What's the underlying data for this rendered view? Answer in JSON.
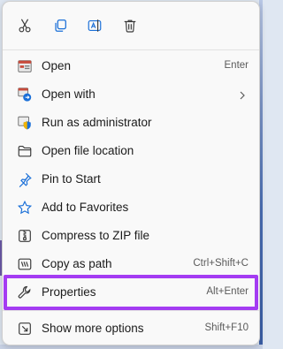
{
  "toolbar": {
    "buttons": [
      {
        "name": "cut",
        "icon": "scissors-icon"
      },
      {
        "name": "copy",
        "icon": "copy-icon"
      },
      {
        "name": "rename",
        "icon": "rename-icon"
      },
      {
        "name": "delete",
        "icon": "trash-icon"
      }
    ]
  },
  "menu": {
    "items": [
      {
        "label": "Open",
        "shortcut": "Enter",
        "icon": "open-app-icon"
      },
      {
        "label": "Open with",
        "shortcut": "",
        "icon": "open-with-icon",
        "has_submenu": true
      },
      {
        "label": "Run as administrator",
        "shortcut": "",
        "icon": "shield-icon"
      },
      {
        "label": "Open file location",
        "shortcut": "",
        "icon": "folder-icon"
      },
      {
        "label": "Pin to Start",
        "shortcut": "",
        "icon": "pin-icon"
      },
      {
        "label": "Add to Favorites",
        "shortcut": "",
        "icon": "star-icon"
      },
      {
        "label": "Compress to ZIP file",
        "shortcut": "",
        "icon": "zip-icon"
      },
      {
        "label": "Copy as path",
        "shortcut": "Ctrl+Shift+C",
        "icon": "copy-path-icon"
      },
      {
        "label": "Properties",
        "shortcut": "Alt+Enter",
        "icon": "wrench-icon",
        "highlighted": true
      },
      {
        "label": "Show more options",
        "shortcut": "Shift+F10",
        "icon": "more-options-icon"
      }
    ]
  },
  "colors": {
    "highlight_border": "#a43cf2",
    "accent_blue": "#1a6fd8",
    "menu_background": "#f9f9f9"
  }
}
